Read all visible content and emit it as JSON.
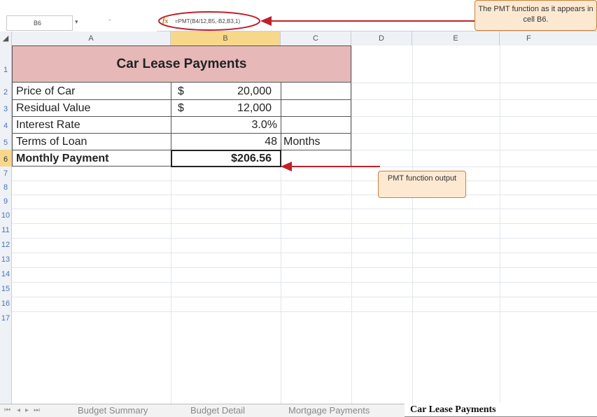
{
  "formula_bar": {
    "name_box": "B6",
    "fx": "fx",
    "formula": "=PMT(B4/12,B5,-B2,B3,1)"
  },
  "callouts": {
    "formula_note": "The PMT function as it appears in cell B6.",
    "output_note": "PMT function output"
  },
  "columns": [
    "A",
    "B",
    "C",
    "D",
    "E",
    "F"
  ],
  "rows": [
    "1",
    "2",
    "3",
    "4",
    "5",
    "6",
    "7",
    "8",
    "9",
    "10",
    "11",
    "12",
    "13",
    "14",
    "15",
    "16",
    "17"
  ],
  "sheet": {
    "title": "Car Lease Payments",
    "price_label": "Price of Car",
    "price_currency": "$",
    "price_value": "20,000",
    "residual_label": "Residual Value",
    "residual_currency": "$",
    "residual_value": "12,000",
    "rate_label": "Interest Rate",
    "rate_value": "3.0%",
    "term_label": "Terms of Loan",
    "term_value": "48",
    "term_unit": "Months",
    "payment_label": "Monthly Payment",
    "payment_value": "$206.56"
  },
  "tabs": [
    "Budget Summary",
    "Budget Detail",
    "Mortgage Payments",
    "Car Lease Payments"
  ],
  "active_tab": "Car Lease Payments",
  "colors": {
    "title_fill": "#e6b9b8",
    "callout_fill": "#fde9d2",
    "arrow": "#c0202a",
    "selected_col": "#f7d88a"
  }
}
